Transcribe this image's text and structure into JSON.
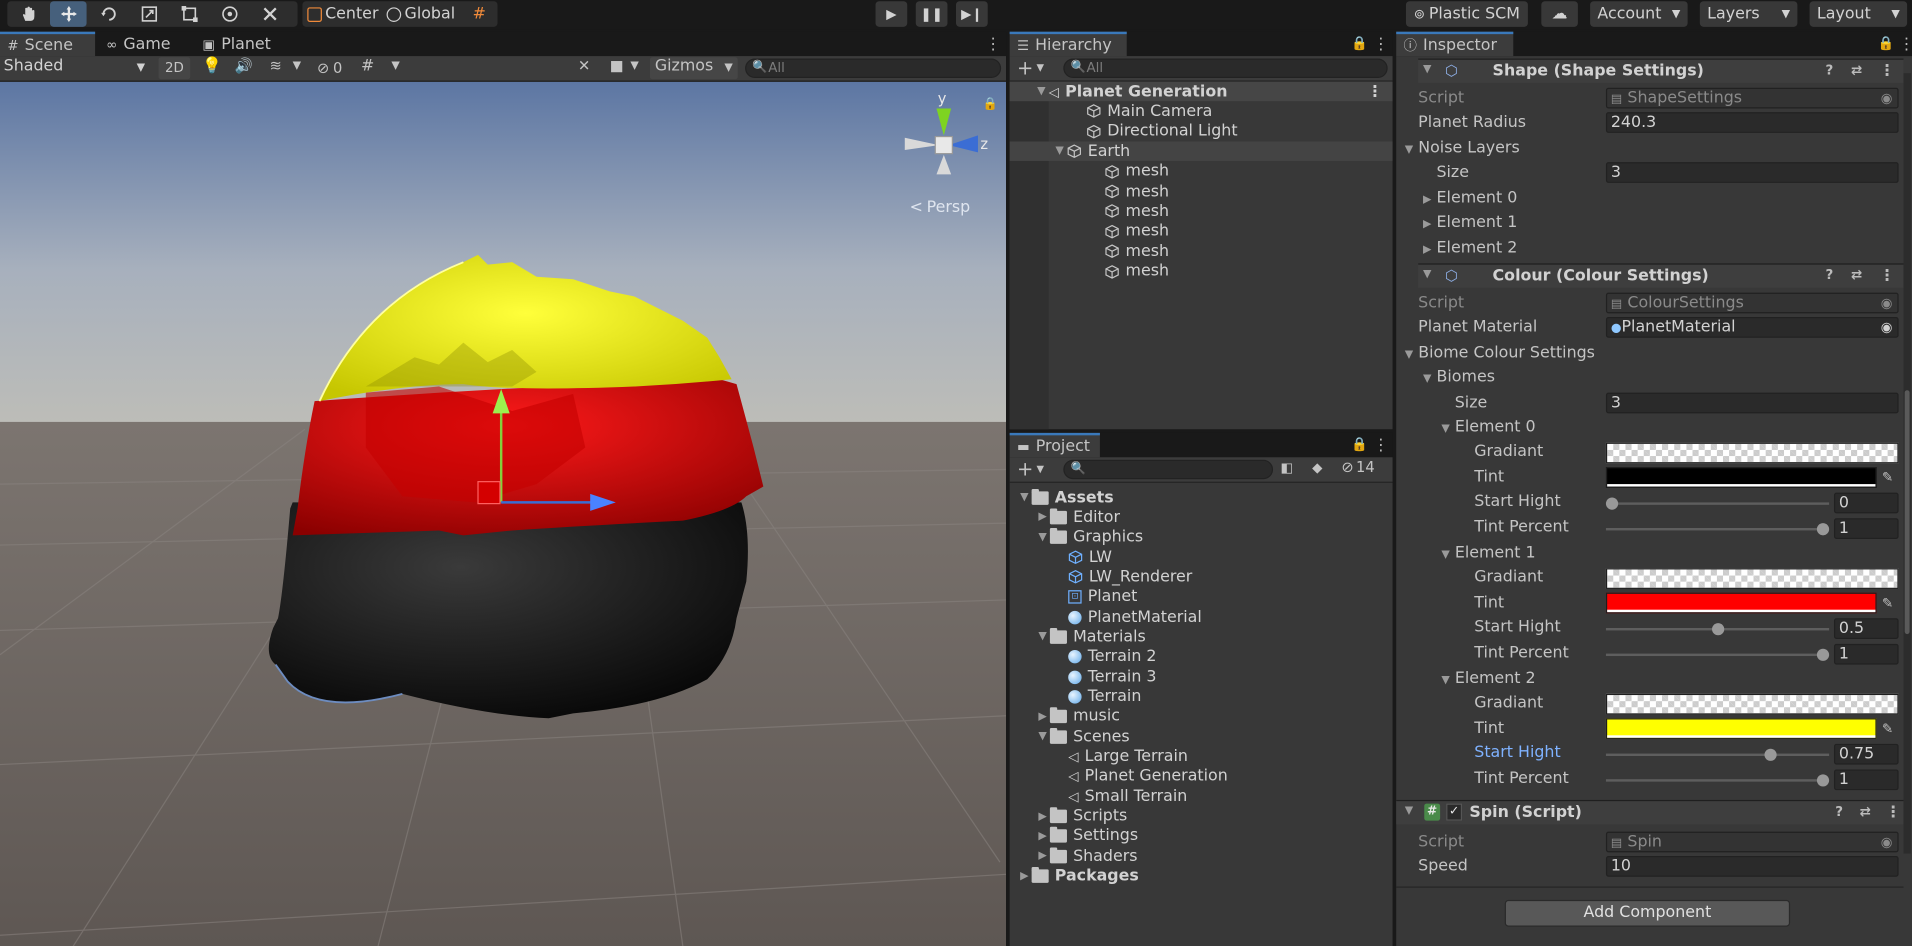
{
  "toolbar": {
    "pivot": "Center",
    "space": "Global",
    "plastic": "Plastic SCM",
    "account": "Account",
    "layers": "Layers",
    "layout": "Layout"
  },
  "scene": {
    "tabs": [
      "Scene",
      "Game",
      "Planet"
    ],
    "shading": "Shaded",
    "mode2d": "2D",
    "hidden_count": "0",
    "gizmos": "Gizmos",
    "search_placeholder": "All",
    "persp": "Persp",
    "axis_y": "y",
    "axis_z": "z"
  },
  "hierarchy": {
    "title": "Hierarchy",
    "search_placeholder": "All",
    "items": [
      {
        "label": "Planet Generation",
        "level": 0,
        "kind": "scene",
        "expanded": true
      },
      {
        "label": "Main Camera",
        "level": 1,
        "kind": "object"
      },
      {
        "label": "Directional Light",
        "level": 1,
        "kind": "object"
      },
      {
        "label": "Earth",
        "level": 1,
        "kind": "object",
        "expanded": true
      },
      {
        "label": "mesh",
        "level": 2,
        "kind": "object"
      },
      {
        "label": "mesh",
        "level": 2,
        "kind": "object"
      },
      {
        "label": "mesh",
        "level": 2,
        "kind": "object"
      },
      {
        "label": "mesh",
        "level": 2,
        "kind": "object"
      },
      {
        "label": "mesh",
        "level": 2,
        "kind": "object"
      },
      {
        "label": "mesh",
        "level": 2,
        "kind": "object"
      }
    ]
  },
  "project": {
    "title": "Project",
    "hidden_count": "14",
    "items": [
      {
        "label": "Assets",
        "level": 0,
        "kind": "folder",
        "expanded": true
      },
      {
        "label": "Editor",
        "level": 1,
        "kind": "folder"
      },
      {
        "label": "Graphics",
        "level": 1,
        "kind": "folder",
        "expanded": true
      },
      {
        "label": "LW",
        "level": 2,
        "kind": "prefab"
      },
      {
        "label": "LW_Renderer",
        "level": 2,
        "kind": "prefab"
      },
      {
        "label": "Planet",
        "level": 2,
        "kind": "asset"
      },
      {
        "label": "PlanetMaterial",
        "level": 2,
        "kind": "material"
      },
      {
        "label": "Materials",
        "level": 1,
        "kind": "folder",
        "expanded": true
      },
      {
        "label": "Terrain 2",
        "level": 2,
        "kind": "material"
      },
      {
        "label": "Terrain 3",
        "level": 2,
        "kind": "material"
      },
      {
        "label": "Terrain",
        "level": 2,
        "kind": "material"
      },
      {
        "label": "music",
        "level": 1,
        "kind": "folder"
      },
      {
        "label": "Scenes",
        "level": 1,
        "kind": "folder",
        "expanded": true
      },
      {
        "label": "Large Terrain",
        "level": 2,
        "kind": "scene"
      },
      {
        "label": "Planet Generation",
        "level": 2,
        "kind": "scene"
      },
      {
        "label": "Small Terrain",
        "level": 2,
        "kind": "scene"
      },
      {
        "label": "Scripts",
        "level": 1,
        "kind": "folder"
      },
      {
        "label": "Settings",
        "level": 1,
        "kind": "folder"
      },
      {
        "label": "Shaders",
        "level": 1,
        "kind": "folder"
      },
      {
        "label": "Packages",
        "level": 0,
        "kind": "folder"
      }
    ]
  },
  "inspector": {
    "title": "Inspector",
    "shape": {
      "header": "Shape (Shape Settings)",
      "script_label": "Script",
      "script_value": "ShapeSettings",
      "radius_label": "Planet Radius",
      "radius_value": "240.3",
      "noise_label": "Noise Layers",
      "size_label": "Size",
      "size_value": "3",
      "elements": [
        "Element 0",
        "Element 1",
        "Element 2"
      ]
    },
    "colour": {
      "header": "Colour (Colour Settings)",
      "script_label": "Script",
      "script_value": "ColourSettings",
      "material_label": "Planet Material",
      "material_value": "PlanetMaterial",
      "biome_label": "Biome Colour Settings",
      "biomes_label": "Biomes",
      "size_label": "Size",
      "size_value": "3",
      "gradient_label": "Gradiant",
      "tint_label": "Tint",
      "start_label": "Start Hight",
      "percent_label": "Tint Percent",
      "elements": [
        {
          "name": "Element 0",
          "tint": "#000000",
          "start": "0",
          "start_frac": 0,
          "percent": "1",
          "percent_frac": 1
        },
        {
          "name": "Element 1",
          "tint": "#ff0000",
          "start": "0.5",
          "start_frac": 0.5,
          "percent": "1",
          "percent_frac": 1
        },
        {
          "name": "Element 2",
          "tint": "#ffff00",
          "start": "0.75",
          "start_frac": 0.75,
          "percent": "1",
          "percent_frac": 1
        }
      ]
    },
    "spin": {
      "header": "Spin (Script)",
      "script_label": "Script",
      "script_value": "Spin",
      "speed_label": "Speed",
      "speed_value": "10"
    },
    "add_component": "Add Component"
  },
  "colors": {
    "accent": "#3a79bb",
    "highlight_label": "#7fb2ff",
    "planet_yellow": "#f3f300",
    "planet_red": "#e30000",
    "planet_black": "#080808"
  }
}
